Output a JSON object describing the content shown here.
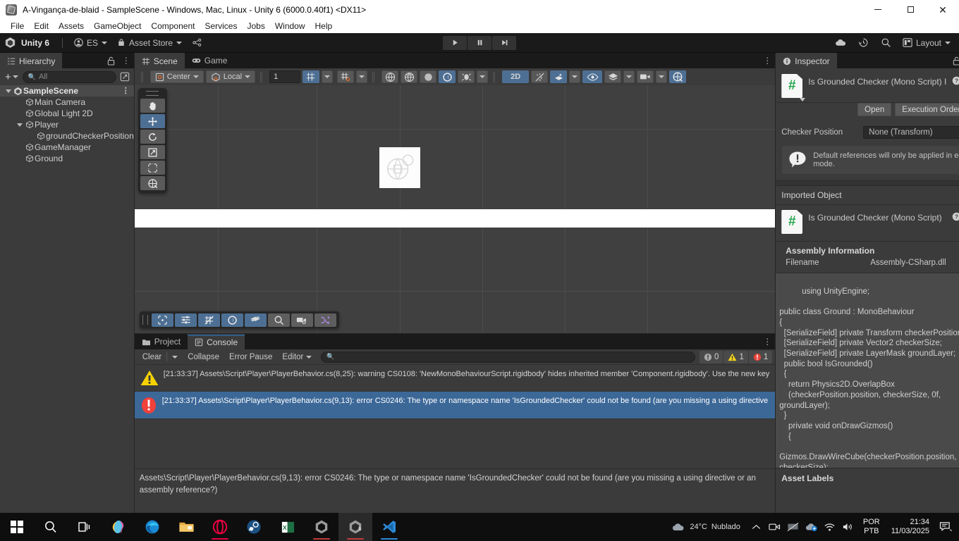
{
  "window": {
    "title": "A-Vingança-de-blaid - SampleScene - Windows, Mac, Linux - Unity 6 (6000.0.40f1) <DX11>",
    "minimize": "—",
    "maximize": "□",
    "close": "✕"
  },
  "menubar": {
    "items": [
      "File",
      "Edit",
      "Assets",
      "GameObject",
      "Component",
      "Services",
      "Jobs",
      "Window",
      "Help"
    ]
  },
  "toolbar": {
    "unity_label": "Unity 6",
    "account_label": "ES",
    "asset_store_label": "Asset Store",
    "collab_icon": "services-icon",
    "play_icon": "play-icon",
    "pause_icon": "pause-icon",
    "step_icon": "step-icon",
    "cloud_icon": "cloud-icon",
    "history_icon": "history-icon",
    "search_icon": "search-icon",
    "layout_label": "Layout",
    "layout_icon": "layout-icon"
  },
  "hierarchy": {
    "tab_label": "Hierarchy",
    "tab_icon": "hierarchy-icon",
    "lock_icon": "lock-open-icon",
    "kebab_icon": "kebab-icon",
    "add_label": "+",
    "search_placeholder": "All",
    "search_value": "",
    "search_icon": "search-icon",
    "visibility_icon": "window-picker-icon",
    "items": [
      {
        "label": "SampleScene",
        "depth": 0,
        "expanded": true,
        "is_scene": true
      },
      {
        "label": "Main Camera",
        "depth": 1,
        "expanded": null,
        "is_scene": false
      },
      {
        "label": "Global Light 2D",
        "depth": 1,
        "expanded": null,
        "is_scene": false
      },
      {
        "label": "Player",
        "depth": 1,
        "expanded": true,
        "is_scene": false
      },
      {
        "label": "groundCheckerPosition",
        "depth": 2,
        "expanded": null,
        "is_scene": false
      },
      {
        "label": "GameManager",
        "depth": 1,
        "expanded": null,
        "is_scene": false
      },
      {
        "label": "Ground",
        "depth": 1,
        "expanded": null,
        "is_scene": false
      }
    ]
  },
  "scene": {
    "tabs": [
      {
        "label": "Scene",
        "icon": "scene-grid-icon",
        "active": true
      },
      {
        "label": "Game",
        "icon": "gamepad-icon",
        "active": false
      }
    ],
    "kebab_icon": "kebab-icon",
    "toolbar": {
      "pivot_label": "Center",
      "pivot_icon": "pivot-center-icon",
      "space_label": "Local",
      "space_icon": "local-space-icon",
      "grid_size_value": "1",
      "grid_snap_icon": "grid-snap-icon",
      "grid_snap_selected": true,
      "snap_increment_icon": "snap-increment-icon",
      "view_options_icons": [
        "shaded-globe-icon",
        "wireframe-globe-icon",
        "sphere-icon",
        "lighting-icon",
        "audio-icon"
      ],
      "mode_2d_label": "2D",
      "mode_2d_selected": true,
      "light_icon": "light-off-icon",
      "fx_icon": "effects-icon",
      "visibility_icon": "scene-visibility-icon",
      "layers_icon": "layers-icon",
      "camera_icon": "camera-icon",
      "gizmos_icon": "gizmos-icon"
    },
    "tools": [
      {
        "name": "hand-tool",
        "selected": false
      },
      {
        "name": "move-tool",
        "selected": true
      },
      {
        "name": "rotate-tool",
        "selected": false
      },
      {
        "name": "scale-tool",
        "selected": false
      },
      {
        "name": "rect-tool",
        "selected": false
      },
      {
        "name": "transform-tool",
        "selected": false
      }
    ],
    "overlay_buttons": [
      {
        "name": "tool-settings-icon",
        "selected": true
      },
      {
        "name": "sliders-icon",
        "selected": true
      },
      {
        "name": "grid-and-snap-icon",
        "selected": true
      },
      {
        "name": "orientation-icon",
        "selected": true
      },
      {
        "name": "layers-overlay-icon",
        "selected": true
      },
      {
        "name": "search-overlay-icon",
        "selected": false
      },
      {
        "name": "camera-overlay-icon",
        "selected": false
      },
      {
        "name": "shuffle-overlay-icon",
        "selected": false
      }
    ]
  },
  "console": {
    "tabs": [
      {
        "label": "Project",
        "icon": "folder-icon",
        "active": false
      },
      {
        "label": "Console",
        "icon": "console-icon",
        "active": true
      }
    ],
    "kebab_icon": "kebab-icon",
    "clear_label": "Clear",
    "collapse_label": "Collapse",
    "error_pause_label": "Error Pause",
    "editor_label": "Editor",
    "search_placeholder": "",
    "search_icon": "search-icon",
    "counts": {
      "log": "0",
      "warning": "1",
      "error": "1"
    },
    "entries": [
      {
        "type": "warning",
        "text": "[21:33:37] Assets\\Script\\Player\\PlayerBehavior.cs(8,25): warning CS0108: 'NewMonoBehaviourScript.rigidbody' hides inherited member 'Component.rigidbody'. Use the new key",
        "selected": false
      },
      {
        "type": "error",
        "text": "[21:33:37] Assets\\Script\\Player\\PlayerBehavior.cs(9,13): error CS0246: The type or namespace name 'IsGroundedChecker' could not be found (are you missing a using directive",
        "selected": true
      }
    ],
    "detail": "Assets\\Script\\Player\\PlayerBehavior.cs(9,13): error CS0246: The type or namespace name 'IsGroundedChecker' could not be found (are you missing a using directive or an assembly reference?)"
  },
  "inspector": {
    "tab_label": "Inspector",
    "tab_icon": "info-icon",
    "lock_icon": "lock-open-icon",
    "kebab_icon": "kebab-icon",
    "script_title": "Is Grounded Checker (Mono Script) I",
    "help_icon": "help-icon",
    "component_kebab_icon": "kebab-icon",
    "open_label": "Open",
    "execution_order_label": "Execution Order...",
    "checker_position_label": "Checker Position",
    "checker_position_value": "None (Transform)",
    "object_picker_icon": "object-picker-icon",
    "helpbox_text": "Default references will only be applied in edit mode.",
    "helpbox_icon": "warning-bubble-icon",
    "imported_object_label": "Imported Object",
    "imported_script_title": "Is Grounded Checker (Mono Script)",
    "assembly_info_label": "Assembly Information",
    "filename_key": "Filename",
    "filename_value": "Assembly-CSharp.dll",
    "code": "using UnityEngine;\n\npublic class Ground : MonoBehaviour\n{\n  [SerializeField] private Transform checkerPosition;\n  [SerializeField] private Vector2 checkerSize;\n  [SerializeField] private LayerMask groundLayer;\n  public bool IsGrounded()\n  {\n    return Physics2D.OverlapBox\n    (checkerPosition.position, checkerSize, 0f,\ngroundLayer);\n  }\n    private void onDrawGizmos()\n    {\n\nGizmos.DrawWireCube(checkerPosition.position,\ncheckerSize);\n    }",
    "asset_labels_title": "Asset Labels",
    "label_tag_icon": "tag-icon"
  },
  "statusbar": {
    "message": "Assets\\Script\\Player\\PlayerBehavior.cs(9,13): error CS0246: The type or namespace name 'IsGroundedChecker' could not be found (are you missing a using directive or an assembly reference?)",
    "error_icon": "error-icon",
    "right_icons": [
      "bug-mute-icon",
      "database-mute-icon",
      "check-circle-icon"
    ]
  },
  "taskbar": {
    "items": [
      {
        "name": "start-button",
        "icon": "windows-icon",
        "active": false
      },
      {
        "name": "search-button",
        "icon": "search-icon",
        "active": false
      },
      {
        "name": "task-view-button",
        "icon": "task-view-icon",
        "active": false
      },
      {
        "name": "copilot-button",
        "icon": "copilot-icon",
        "active": false
      },
      {
        "name": "edge-button",
        "icon": "edge-icon",
        "active": false
      },
      {
        "name": "file-explorer-button",
        "icon": "folder-icon",
        "active": false
      },
      {
        "name": "opera-button",
        "icon": "opera-icon",
        "active": false
      },
      {
        "name": "steam-button",
        "icon": "steam-icon",
        "active": false
      },
      {
        "name": "excel-button",
        "icon": "excel-icon",
        "active": false
      },
      {
        "name": "unity-hub-button",
        "icon": "unity-hub-icon",
        "active": false
      },
      {
        "name": "unity-editor-button",
        "icon": "unity-6-icon",
        "active": true
      },
      {
        "name": "vscode-button",
        "icon": "vscode-icon",
        "active": false
      }
    ],
    "weather_temp": "24°C",
    "weather_desc": "Nublado",
    "tray_icons": [
      "chevron-up-icon",
      "camera-tray-icon",
      "screen-tray-icon",
      "onedrive-icon",
      "wifi-icon",
      "volume-icon"
    ],
    "language_top": "POR",
    "language_bottom": "PTB",
    "clock_time": "21:34",
    "clock_date": "11/03/2025",
    "notification_icon": "notification-icon"
  }
}
